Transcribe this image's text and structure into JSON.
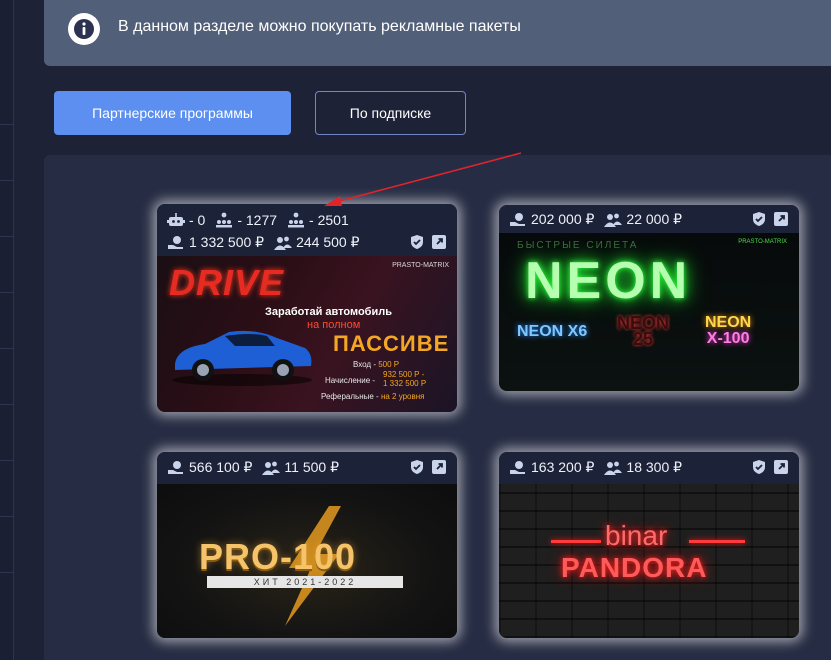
{
  "banner": {
    "text": "В данном разделе можно покупать рекламные пакеты"
  },
  "tabs": {
    "partner_label": "Партнерские программы",
    "subscription_label": "По подписке"
  },
  "cards": {
    "drive": {
      "stat_robot": "- 0",
      "stat_level1": "- 1277",
      "stat_level2": "- 2501",
      "stat_money": "1 332 500 ₽",
      "stat_partners": "244 500 ₽",
      "image": {
        "title": "DRIVE",
        "brand": "PRASTO-MATRIX",
        "line1": "Заработай автомобиль",
        "line2": "на полном",
        "line3": "ПАССИВЕ",
        "entry_label": "Вход -",
        "entry_value": "500 Р",
        "accrual_label": "Начисление -",
        "accrual_value1": "932 500 Р -",
        "accrual_value2": "1 332 500 Р",
        "referral_label": "Реферальные -",
        "referral_value": "на 2 уровня"
      }
    },
    "neon": {
      "stat_money": "202 000 ₽",
      "stat_partners": "22 000 ₽",
      "image": {
        "top": "БЫСТРЫЕ СИЛЕТА",
        "logo": "PRASTO-MATRIX",
        "main": "NEON",
        "x6": "NEON X6",
        "n25_top": "NEON",
        "n25_bottom": "25",
        "x100_top": "NEON",
        "x100_bottom": "X-100"
      }
    },
    "pro100": {
      "stat_money": "566 100 ₽",
      "stat_partners": "11 500 ₽",
      "image": {
        "main": "PRO-100",
        "bar": "ХИТ 2021-2022"
      }
    },
    "pandora": {
      "stat_money": "163 200 ₽",
      "stat_partners": "18 300 ₽",
      "image": {
        "binar": "binar",
        "main": "PANDORA"
      }
    }
  },
  "colors": {
    "page_bg": "#1d2236",
    "banner_bg": "#525f79",
    "accent": "#5c8ff0",
    "panel_bg": "#262c43",
    "arrow": "#e0242a"
  }
}
